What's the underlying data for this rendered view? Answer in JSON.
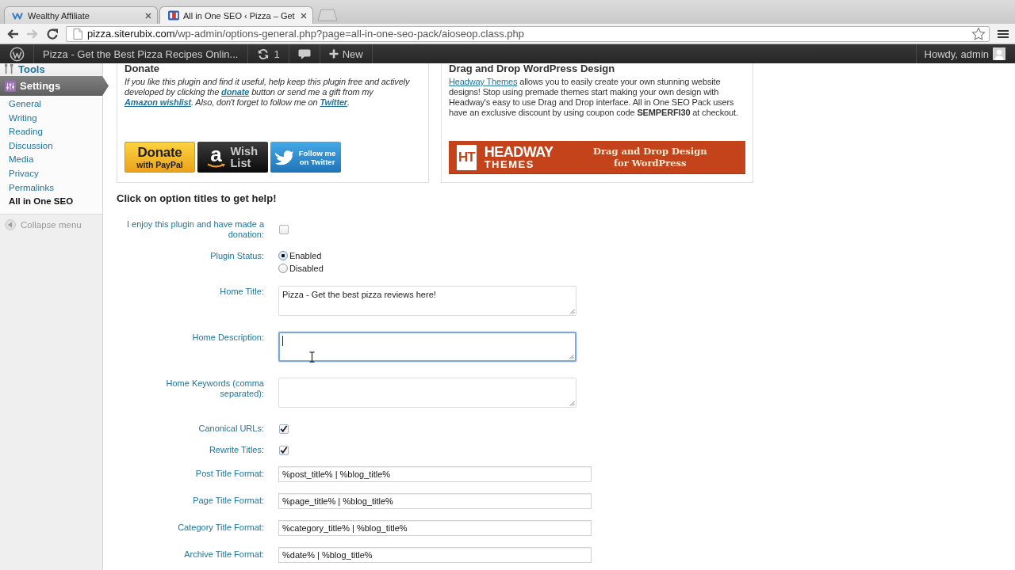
{
  "browser": {
    "tabs": [
      {
        "title": "Wealthy Affiliate",
        "selected": false
      },
      {
        "title": "All in One SEO ‹ Pizza – Get",
        "selected": true
      }
    ],
    "nav": [
      {
        "kind": "back",
        "disabled": false
      },
      {
        "kind": "forward",
        "disabled": true
      },
      {
        "kind": "reload",
        "disabled": false
      }
    ],
    "url": {
      "host": "pizza.siterubix.com",
      "path": "/wp-admin/options-general.php?page=all-in-one-seo-pack/aioseop.class.php"
    }
  },
  "admin_bar": {
    "site_name": "Pizza - Get the Best Pizza Recipes Onlin...",
    "updates": "1",
    "new": "New",
    "greeting": "Howdy, admin"
  },
  "sidebar": {
    "menu": [
      {
        "label": "Tools",
        "selected": false
      },
      {
        "label": "Settings",
        "selected": true
      }
    ],
    "submenu": [
      {
        "label": "General",
        "selected": false
      },
      {
        "label": "Writing",
        "selected": false
      },
      {
        "label": "Reading",
        "selected": false
      },
      {
        "label": "Discussion",
        "selected": false
      },
      {
        "label": "Media",
        "selected": false
      },
      {
        "label": "Privacy",
        "selected": false
      },
      {
        "label": "Permalinks",
        "selected": false
      },
      {
        "label": "All in One SEO",
        "selected": true
      }
    ],
    "collapse": "Collapse menu"
  },
  "promo_boxes": [
    {
      "kind": "donate",
      "heading": "Donate",
      "paragraph": [
        {
          "kind": "text",
          "text": "If you like this plugin and find it useful, help keep this plugin free and actively developed by clicking the "
        },
        {
          "kind": "link",
          "text": "donate"
        },
        {
          "kind": "text",
          "text": " button or send me a gift from my "
        },
        {
          "kind": "link",
          "text": "Amazon wishlist"
        },
        {
          "kind": "text",
          "text": ". Also, don't forget to follow me on "
        },
        {
          "kind": "link",
          "text": "Twitter"
        },
        {
          "kind": "text",
          "text": "."
        }
      ],
      "buttons": [
        {
          "kind": "paypal",
          "title": "Donate",
          "subtitle": "with PayPal"
        },
        {
          "kind": "amazon",
          "logo": "a",
          "title": "Wish List"
        },
        {
          "kind": "twitter",
          "title": "Follow me on Twitter"
        }
      ]
    },
    {
      "kind": "headway",
      "heading": "Drag and Drop WordPress Design",
      "paragraph": [
        {
          "kind": "link",
          "text": "Headway Themes"
        },
        {
          "kind": "text",
          "text": " allows you to easily create your own stunning website designs! Stop using premade themes start making your own design with Headway's easy to use Drag and Drop interface. All in One SEO Pack users have an exclusive discount by using coupon code **SEMPERFI30** at checkout."
        }
      ],
      "banner": {
        "logo": "HT",
        "brand": "HEADWAY",
        "brand_sub": "THEMES",
        "tagline": "Drag and Drop Design for WordPress"
      }
    }
  ],
  "form": {
    "heading": "Click on option titles to get help!",
    "fields": [
      {
        "kind": "checkbox",
        "label": "I enjoy this plugin and have made a donation:",
        "checked": false
      },
      {
        "kind": "radio",
        "label": "Plugin Status:",
        "options": [
          {
            "label": "Enabled",
            "selected": true
          },
          {
            "label": "Disabled",
            "selected": false
          }
        ]
      },
      {
        "kind": "textarea",
        "label": "Home Title:",
        "value": "Pizza - Get the best pizza reviews here!",
        "focused": false
      },
      {
        "kind": "textarea",
        "label": "Home Description:",
        "focused": true
      },
      {
        "kind": "textarea",
        "label": "Home Keywords (comma separated):",
        "focused": false
      },
      {
        "kind": "checkbox",
        "label": "Canonical URLs:",
        "checked": true
      },
      {
        "kind": "checkbox",
        "label": "Rewrite Titles:",
        "checked": true
      },
      {
        "kind": "text",
        "label": "Post Title Format:",
        "value": "%post_title% | %blog_title%",
        "focused": false
      },
      {
        "kind": "text",
        "label": "Page Title Format:",
        "value": "%page_title% | %blog_title%",
        "focused": false
      },
      {
        "kind": "text",
        "label": "Category Title Format:",
        "value": "%category_title% | %blog_title%",
        "focused": false
      },
      {
        "kind": "text",
        "label": "Archive Title Format:",
        "value": "%date% | %blog_title%",
        "focused": false
      }
    ]
  }
}
